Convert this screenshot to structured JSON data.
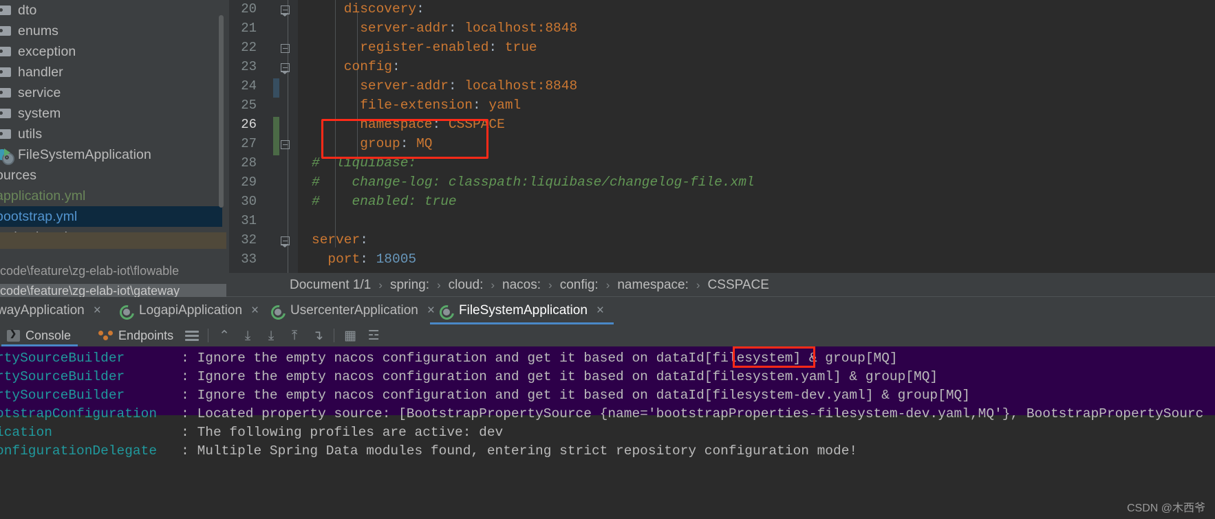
{
  "sidebar": {
    "items": [
      {
        "label": "dto",
        "icon": "folder-icon",
        "style": "normal",
        "clipped": true
      },
      {
        "label": "enums",
        "icon": "folder-icon",
        "style": "normal"
      },
      {
        "label": "exception",
        "icon": "folder-icon",
        "style": "normal"
      },
      {
        "label": "handler",
        "icon": "folder-icon",
        "style": "normal"
      },
      {
        "label": "service",
        "icon": "folder-icon",
        "style": "normal"
      },
      {
        "label": "system",
        "icon": "folder-icon",
        "style": "normal"
      },
      {
        "label": "utils",
        "icon": "folder-icon",
        "style": "normal"
      },
      {
        "label": "FileSystemApplication",
        "icon": "spring-class-icon",
        "style": "normal"
      },
      {
        "label": "ources",
        "icon": "none",
        "style": "normal"
      },
      {
        "label": "application.yml",
        "icon": "none",
        "style": "green"
      },
      {
        "label": "bootstrap.yml",
        "icon": "none",
        "style": "selected"
      },
      {
        "label": "logback.xml",
        "icon": "none",
        "style": "normal"
      }
    ],
    "paths": [
      "code\\feature\\zg-elab-iot\\flowable",
      "code\\feature\\zg-elab-iot\\gateway"
    ]
  },
  "editor": {
    "first_line_number": 20,
    "current_line": 26,
    "lines": [
      {
        "n": 20,
        "indent": 4,
        "tokens": [
          {
            "t": "discovery",
            "c": "key"
          },
          {
            "t": ":",
            "c": "val"
          }
        ]
      },
      {
        "n": 21,
        "indent": 6,
        "tokens": [
          {
            "t": "server-addr",
            "c": "key"
          },
          {
            "t": ": ",
            "c": "val"
          },
          {
            "t": "localhost:8848",
            "c": "key"
          }
        ]
      },
      {
        "n": 22,
        "indent": 6,
        "tokens": [
          {
            "t": "register-enabled",
            "c": "key"
          },
          {
            "t": ": ",
            "c": "val"
          },
          {
            "t": "true",
            "c": "key"
          }
        ]
      },
      {
        "n": 23,
        "indent": 4,
        "tokens": [
          {
            "t": "config",
            "c": "key"
          },
          {
            "t": ":",
            "c": "val"
          }
        ]
      },
      {
        "n": 24,
        "indent": 6,
        "tokens": [
          {
            "t": "server-addr",
            "c": "key"
          },
          {
            "t": ": ",
            "c": "val"
          },
          {
            "t": "localhost:8848",
            "c": "key"
          }
        ]
      },
      {
        "n": 25,
        "indent": 6,
        "tokens": [
          {
            "t": "file-extension",
            "c": "key"
          },
          {
            "t": ": ",
            "c": "val"
          },
          {
            "t": "yaml",
            "c": "key"
          }
        ]
      },
      {
        "n": 26,
        "indent": 6,
        "tokens": [
          {
            "t": "namespace",
            "c": "key"
          },
          {
            "t": ": ",
            "c": "val"
          },
          {
            "t": "CSSPACE",
            "c": "key"
          }
        ]
      },
      {
        "n": 27,
        "indent": 6,
        "tokens": [
          {
            "t": "group",
            "c": "key"
          },
          {
            "t": ": ",
            "c": "val"
          },
          {
            "t": "MQ",
            "c": "key"
          }
        ]
      },
      {
        "n": 28,
        "indent": 0,
        "tokens": [
          {
            "t": "#  liquibase:",
            "c": "cm"
          }
        ]
      },
      {
        "n": 29,
        "indent": 0,
        "tokens": [
          {
            "t": "#    change-log: classpath:liquibase/changelog-file.xml",
            "c": "cm"
          }
        ]
      },
      {
        "n": 30,
        "indent": 0,
        "tokens": [
          {
            "t": "#    enabled: true",
            "c": "cm"
          }
        ]
      },
      {
        "n": 31,
        "indent": 0,
        "tokens": []
      },
      {
        "n": 32,
        "indent": 0,
        "tokens": [
          {
            "t": "server",
            "c": "key"
          },
          {
            "t": ":",
            "c": "val"
          }
        ]
      },
      {
        "n": 33,
        "indent": 2,
        "tokens": [
          {
            "t": "port",
            "c": "key"
          },
          {
            "t": ": ",
            "c": "val"
          },
          {
            "t": "18005",
            "c": "num"
          }
        ]
      }
    ],
    "highlight_box_label": "red-annotation-around-namespace-and-group"
  },
  "breadcrumb": {
    "crumbs": [
      "Document 1/1",
      "spring:",
      "cloud:",
      "nacos:",
      "config:",
      "namespace:",
      "CSSPACE"
    ],
    "separator": "›"
  },
  "run_tabs": {
    "items": [
      {
        "label": "wayApplication",
        "active": false,
        "icon": "spring-run-icon",
        "close": "×"
      },
      {
        "label": "LogapiApplication",
        "active": false,
        "icon": "spring-run-icon",
        "close": "×"
      },
      {
        "label": "UsercenterApplication",
        "active": false,
        "icon": "spring-run-icon",
        "close": "×"
      },
      {
        "label": "FileSystemApplication",
        "active": true,
        "icon": "spring-run-icon",
        "close": "×"
      }
    ]
  },
  "console_toolbar": {
    "tabs": [
      {
        "label": "Console",
        "icon": "console-icon",
        "active": true
      },
      {
        "label": "Endpoints",
        "icon": "endpoints-icon",
        "active": false
      }
    ],
    "buttons": [
      {
        "name": "wrap-lines-icon",
        "glyph": "≡"
      },
      {
        "name": "soft-wrap-icon",
        "glyph": "⌃"
      },
      {
        "name": "scroll-to-end-icon",
        "glyph": "⤓"
      },
      {
        "name": "scroll-down-icon",
        "glyph": "⤓"
      },
      {
        "name": "scroll-up-icon",
        "glyph": "⤒"
      },
      {
        "name": "print-icon",
        "glyph": "↴"
      },
      {
        "name": "table-view-icon",
        "glyph": "▦"
      },
      {
        "name": "settings-icon",
        "glyph": "☲"
      }
    ]
  },
  "console_output": {
    "lines": [
      {
        "cls": "rtySourceBuilder",
        "sep": ":",
        "msg": "Ignore the empty nacos configuration and get it based on dataId[filesystem] & group[MQ]",
        "selected": true
      },
      {
        "cls": "rtySourceBuilder",
        "sep": ":",
        "msg": "Ignore the empty nacos configuration and get it based on dataId[filesystem.yaml] & group[MQ]",
        "selected": true
      },
      {
        "cls": "rtySourceBuilder",
        "sep": ":",
        "msg": "Ignore the empty nacos configuration and get it based on dataId[filesystem-dev.yaml] & group[MQ]",
        "selected": true
      },
      {
        "cls": "otstrapConfiguration",
        "sep": ":",
        "msg": "Located property source: [BootstrapPropertySource {name='bootstrapProperties-filesystem-dev.yaml,MQ'}, BootstrapPropertySourc",
        "selected": false
      },
      {
        "cls": "ication",
        "sep": ":",
        "msg": "The following profiles are active: dev",
        "selected": false
      },
      {
        "cls": "onfigurationDelegate",
        "sep": ":",
        "msg": "Multiple Spring Data modules found, entering strict repository configuration mode!",
        "selected": false
      }
    ],
    "highlight_box_label": "red-annotation-around-group-MQ"
  },
  "watermark": "CSDN @木西爷",
  "colors": {
    "accent_blue": "#4a88c7",
    "annotation_red": "#ff2a18",
    "editor_bg": "#2b2b2b",
    "panel_bg": "#3c3f41",
    "selection_purple": "#2d0049",
    "yaml_key": "#cc7832",
    "comment_green": "#629755",
    "log_class_cyan": "#20999d"
  }
}
